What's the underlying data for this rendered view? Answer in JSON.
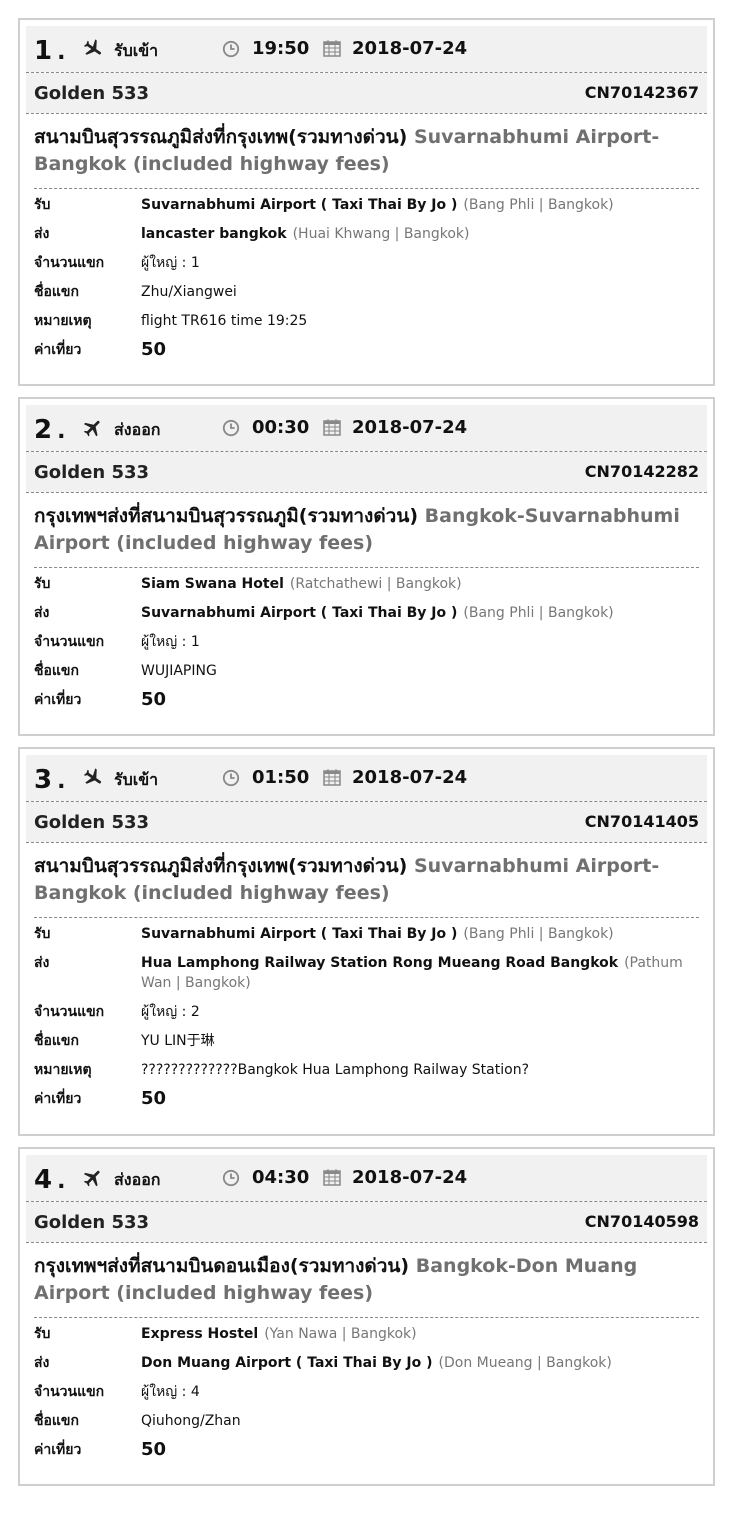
{
  "bookings": [
    {
      "index": "1",
      "type_label": "รับเข้า",
      "direction": "arrival",
      "time": "19:50",
      "date": "2018-07-24",
      "driver": "Golden 533",
      "code": "CN70142367",
      "route_th": "สนามบินสุวรรณภูมิส่งที่กรุงเทพ(รวมทางด่วน)",
      "route_en": "Suvarnabhumi Airport-Bangkok (included highway fees)",
      "labels": {
        "pickup": "รับ",
        "dropoff": "ส่ง",
        "passengers": "จำนวนแขก",
        "guest": "ชื่อแขก",
        "note": "หมายเหตุ",
        "fare": "ค่าเที่ยว"
      },
      "pickup": {
        "place": "Suvarnabhumi Airport ( Taxi Thai By Jo )",
        "area": "(Bang Phli | Bangkok)"
      },
      "dropoff": {
        "place": "lancaster bangkok",
        "area": "(Huai Khwang | Bangkok)"
      },
      "passengers": "ผู้ใหญ่ : 1",
      "guest": "Zhu/Xiangwei",
      "note": "flight TR616 time 19:25",
      "fare": "50"
    },
    {
      "index": "2",
      "type_label": "ส่งออก",
      "direction": "departure",
      "time": "00:30",
      "date": "2018-07-24",
      "driver": "Golden 533",
      "code": "CN70142282",
      "route_th": "กรุงเทพฯส่งที่สนามบินสุวรรณภูมิ(รวมทางด่วน)",
      "route_en": "Bangkok-Suvarnabhumi Airport (included highway fees)",
      "labels": {
        "pickup": "รับ",
        "dropoff": "ส่ง",
        "passengers": "จำนวนแขก",
        "guest": "ชื่อแขก",
        "note": "หมายเหตุ",
        "fare": "ค่าเที่ยว"
      },
      "pickup": {
        "place": "Siam Swana Hotel",
        "area": "(Ratchathewi | Bangkok)"
      },
      "dropoff": {
        "place": "Suvarnabhumi Airport ( Taxi Thai By Jo )",
        "area": "(Bang Phli | Bangkok)"
      },
      "passengers": "ผู้ใหญ่ : 1",
      "guest": "WUJIAPING",
      "note": "",
      "fare": "50"
    },
    {
      "index": "3",
      "type_label": "รับเข้า",
      "direction": "arrival",
      "time": "01:50",
      "date": "2018-07-24",
      "driver": "Golden 533",
      "code": "CN70141405",
      "route_th": "สนามบินสุวรรณภูมิส่งที่กรุงเทพ(รวมทางด่วน)",
      "route_en": "Suvarnabhumi Airport-Bangkok (included highway fees)",
      "labels": {
        "pickup": "รับ",
        "dropoff": "ส่ง",
        "passengers": "จำนวนแขก",
        "guest": "ชื่อแขก",
        "note": "หมายเหตุ",
        "fare": "ค่าเที่ยว"
      },
      "pickup": {
        "place": "Suvarnabhumi Airport ( Taxi Thai By Jo )",
        "area": "(Bang Phli | Bangkok)"
      },
      "dropoff": {
        "place": "Hua Lamphong Railway Station Rong Mueang Road Bangkok",
        "area": "(Pathum Wan | Bangkok)"
      },
      "passengers": "ผู้ใหญ่ : 2",
      "guest": "YU LIN于琳",
      "note": "?????????????Bangkok Hua Lamphong Railway Station?",
      "fare": "50"
    },
    {
      "index": "4",
      "type_label": "ส่งออก",
      "direction": "departure",
      "time": "04:30",
      "date": "2018-07-24",
      "driver": "Golden 533",
      "code": "CN70140598",
      "route_th": "กรุงเทพฯส่งที่สนามบินดอนเมือง(รวมทางด่วน)",
      "route_en": "Bangkok-Don Muang Airport (included highway fees)",
      "labels": {
        "pickup": "รับ",
        "dropoff": "ส่ง",
        "passengers": "จำนวนแขก",
        "guest": "ชื่อแขก",
        "note": "หมายเหตุ",
        "fare": "ค่าเที่ยว"
      },
      "pickup": {
        "place": "Express Hostel",
        "area": "(Yan Nawa | Bangkok)"
      },
      "dropoff": {
        "place": "Don Muang Airport ( Taxi Thai By Jo )",
        "area": "(Don Mueang | Bangkok)"
      },
      "passengers": "ผู้ใหญ่ : 4",
      "guest": "Qiuhong/Zhan",
      "note": "",
      "fare": "50"
    }
  ]
}
